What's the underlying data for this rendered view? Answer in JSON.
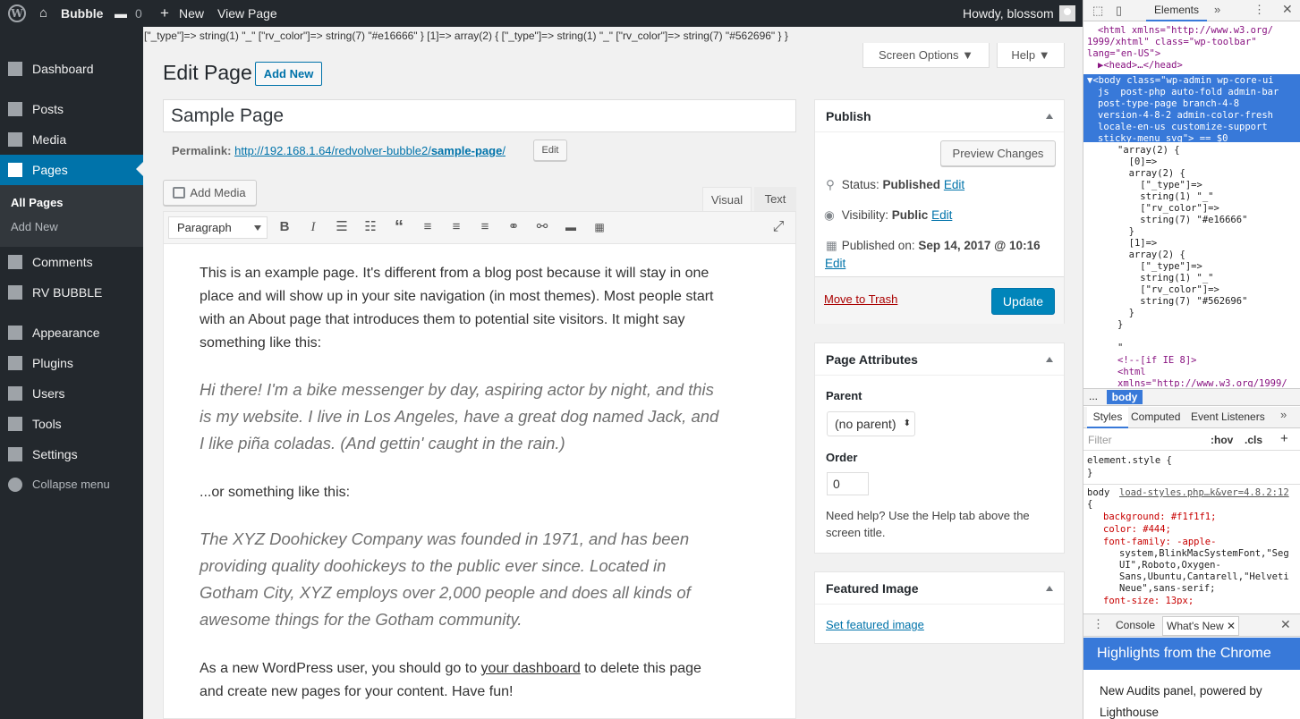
{
  "adminbar": {
    "site_name": "Bubble",
    "comments_count": "0",
    "new_label": "New",
    "view_page": "View Page",
    "howdy": "Howdy, blossom"
  },
  "sidebar": {
    "items": [
      {
        "label": "Dashboard",
        "icon": "dashboard-icon"
      },
      {
        "label": "Posts",
        "icon": "pin-icon"
      },
      {
        "label": "Media",
        "icon": "media-icon"
      },
      {
        "label": "Pages",
        "icon": "pages-icon"
      },
      {
        "label": "Comments",
        "icon": "comment-icon"
      },
      {
        "label": "RV BUBBLE",
        "icon": "pin-icon"
      },
      {
        "label": "Appearance",
        "icon": "brush-icon"
      },
      {
        "label": "Plugins",
        "icon": "plugin-icon"
      },
      {
        "label": "Users",
        "icon": "user-icon"
      },
      {
        "label": "Tools",
        "icon": "wrench-icon"
      },
      {
        "label": "Settings",
        "icon": "settings-icon"
      },
      {
        "label": "Collapse menu",
        "icon": "collapse-icon"
      }
    ],
    "submenu": [
      "All Pages",
      "Add New"
    ]
  },
  "debug_dump": "[\"_type\"]=> string(1) \"_\" [\"rv_color\"]=> string(7) \"#e16666\" } [1]=> array(2) { [\"_type\"]=> string(1) \"_\" [\"rv_color\"]=> string(7) \"#562696\" } }",
  "screen_options": "Screen Options",
  "help": "Help",
  "page": {
    "heading": "Edit Page",
    "add_new": "Add New",
    "title_value": "Sample Page",
    "permalink_label": "Permalink:",
    "permalink_base": "http://192.168.1.64/redvolver-bubble2/",
    "permalink_slug": "sample-page",
    "permalink_end": "/",
    "permalink_edit": "Edit"
  },
  "editor": {
    "add_media": "Add Media",
    "tab_visual": "Visual",
    "tab_text": "Text",
    "format_select": "Paragraph",
    "content": {
      "p1": "This is an example page. It's different from a blog post because it will stay in one place and will show up in your site navigation (in most themes). Most people start with an About page that introduces them to potential site visitors. It might say something like this:",
      "q1": "Hi there! I'm a bike messenger by day, aspiring actor by night, and this is my website. I live in Los Angeles, have a great dog named Jack, and I like piña coladas. (And gettin' caught in the rain.)",
      "p2": "...or something like this:",
      "q2": "The XYZ Doohickey Company was founded in 1971, and has been providing quality doohickeys to the public ever since. Located in Gotham City, XYZ employs over 2,000 people and does all kinds of awesome things for the Gotham community.",
      "p3_before": "As a new WordPress user, you should go to ",
      "p3_link": "your dashboard",
      "p3_after": " to delete this page and create new pages for your content. Have fun!"
    }
  },
  "publish": {
    "title": "Publish",
    "preview": "Preview Changes",
    "status_label": "Status: ",
    "status_value": "Published",
    "visibility_label": "Visibility: ",
    "visibility_value": "Public",
    "published_on_label": "Published on: ",
    "published_on_value": "Sep 14, 2017 @ 10:16",
    "edit": "Edit",
    "trash": "Move to Trash",
    "update": "Update"
  },
  "attributes": {
    "title": "Page Attributes",
    "parent_label": "Parent",
    "parent_value": "(no parent)",
    "order_label": "Order",
    "order_value": "0",
    "help": "Need help? Use the Help tab above the screen title."
  },
  "featured": {
    "title": "Featured Image",
    "link": "Set featured image"
  },
  "devtools": {
    "tab_elements": "Elements",
    "dom_lines": [
      "<html xmlns=\"http://www.w3.org/",
      "1999/xhtml\" class=\"wp-toolbar\"",
      "lang=\"en-US\">",
      "▶<head>…</head>"
    ],
    "body_lines": [
      "▼<body class=\"wp-admin wp-core-ui",
      "js  post-php auto-fold admin-bar",
      "post-type-page branch-4-8",
      "version-4-8-2 admin-color-fresh",
      "locale-en-us customize-support",
      "sticky-menu svg\"> == $0"
    ],
    "array_lines": [
      "\"array(2) {",
      "  [0]=>",
      "  array(2) {",
      "    [\"_type\"]=>",
      "    string(1) \"_\"",
      "    [\"rv_color\"]=>",
      "    string(7) \"#e16666\"",
      "  }",
      "  [1]=>",
      "  array(2) {",
      "    [\"_type\"]=>",
      "    string(1) \"_\"",
      "    [\"rv_color\"]=>",
      "    string(7) \"#562696\"",
      "  }",
      "}",
      "",
      "\"",
      "<!--[if IE 8]>",
      "<html",
      "xmlns=\"http://www.w3.org/1999/"
    ],
    "breadcrumb": "body",
    "breadcrumb_dots": "...",
    "styles_tabs": [
      "Styles",
      "Computed",
      "Event Listeners"
    ],
    "filter_placeholder": "Filter",
    "hov": ":hov",
    "cls": ".cls",
    "element_style": "element.style {",
    "close_brace": "}",
    "body_selector": "body",
    "body_source": "load-styles.php…k&ver=4.8.2:12",
    "open_brace": "{",
    "css_lines": [
      "background: #f1f1f1;",
      "color: #444;",
      "font-family: -apple-",
      "system,BlinkMacSystemFont,\"Seg",
      "UI\",Roboto,Oxygen-",
      "Sans,Ubuntu,Cantarell,\"Helveti",
      "Neue\",sans-serif;",
      "font-size: 13px;"
    ],
    "console_tab": "Console",
    "whatsnew_tab": "What's New",
    "highlights": "Highlights from the Chrome",
    "audits": "New Audits panel, powered by",
    "lighthouse": "Lighthouse"
  }
}
